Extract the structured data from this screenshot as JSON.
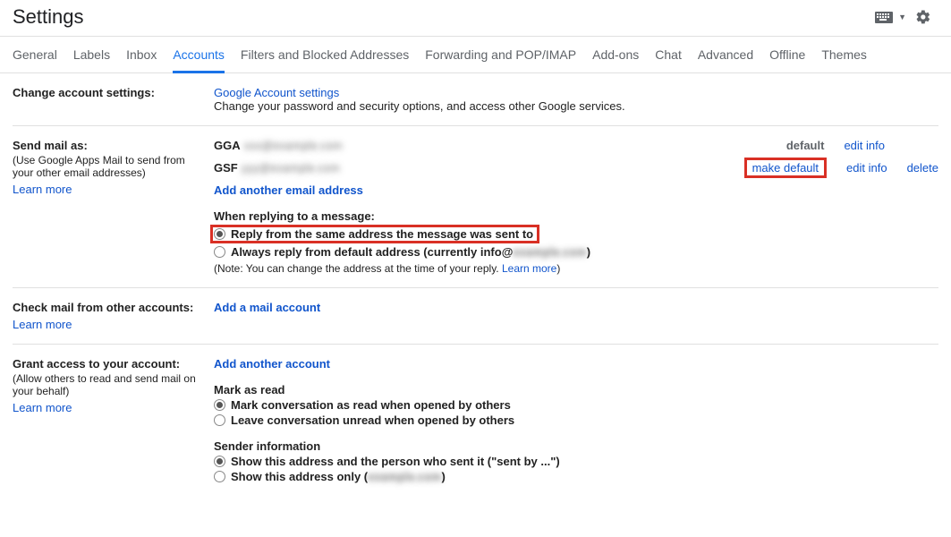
{
  "header": {
    "title": "Settings"
  },
  "tabs": [
    "General",
    "Labels",
    "Inbox",
    "Accounts",
    "Filters and Blocked Addresses",
    "Forwarding and POP/IMAP",
    "Add-ons",
    "Chat",
    "Advanced",
    "Offline",
    "Themes"
  ],
  "activeTab": "Accounts",
  "sections": {
    "changeAccount": {
      "label": "Change account settings:",
      "link": "Google Account settings",
      "desc": "Change your password and security options, and access other Google services."
    },
    "sendMail": {
      "label": "Send mail as:",
      "sub": "(Use Google Apps Mail to send from your other email addresses)",
      "learn": "Learn more",
      "rows": [
        {
          "name": "GGA",
          "blur": "xxx@example.com",
          "default": "default",
          "editInfo": "edit info"
        },
        {
          "name": "GSF",
          "blur": "yyy@example.com",
          "makeDefault": "make default",
          "editInfo": "edit info",
          "delete": "delete"
        }
      ],
      "addAnother": "Add another email address",
      "replyHeading": "When replying to a message:",
      "replyOpt1": "Reply from the same address the message was sent to",
      "replyOpt2a": "Always reply from default address (currently info@",
      "replyOpt2blur": "example.com",
      "replyOpt2c": ")",
      "noteA": "(Note: You can change the address at the time of your reply. ",
      "noteLearn": "Learn more",
      "noteB": ")"
    },
    "checkMail": {
      "label": "Check mail from other accounts:",
      "learn": "Learn more",
      "add": "Add a mail account"
    },
    "grantAccess": {
      "label": "Grant access to your account:",
      "sub": "(Allow others to read and send mail on your behalf)",
      "learn": "Learn more",
      "add": "Add another account",
      "markHead": "Mark as read",
      "markOpt1": "Mark conversation as read when opened by others",
      "markOpt2": "Leave conversation unread when opened by others",
      "senderHead": "Sender information",
      "senderOpt1": "Show this address and the person who sent it (\"sent by ...\")",
      "senderOpt2a": "Show this address only (",
      "senderOpt2blur": "example.com",
      "senderOpt2b": ")"
    }
  }
}
